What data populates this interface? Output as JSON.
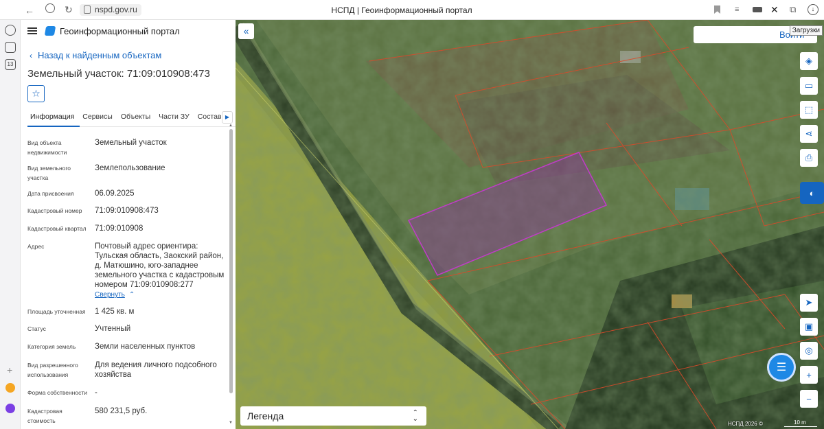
{
  "browser": {
    "url": "nspd.gov.ru",
    "tab_title": "НСПД | Геоинформационный портал",
    "tooltip": "Загрузки",
    "sidebar_counter": "13"
  },
  "header": {
    "portal_title": "Геоинформационный портал",
    "back_link": "Назад к найденным объектам",
    "object_title": "Земельный участок: 71:09:010908:473"
  },
  "tabs": [
    {
      "label": "Информация"
    },
    {
      "label": "Сервисы"
    },
    {
      "label": "Объекты"
    },
    {
      "label": "Части ЗУ"
    },
    {
      "label": "Состав"
    }
  ],
  "fields": [
    {
      "label": "Вид объекта недвижимости",
      "value": "Земельный участок"
    },
    {
      "label": "Вид земельного участка",
      "value": "Землепользование"
    },
    {
      "label": "Дата присвоения",
      "value": "06.09.2025"
    },
    {
      "label": "Кадастровый номер",
      "value": "71:09:010908:473"
    },
    {
      "label": "Кадастровый квартал",
      "value": "71:09:010908"
    },
    {
      "label": "Адрес",
      "value": "Почтовый адрес ориентира: Тульская область, Заокский район, д. Матюшино, юго-западнее земельного участка с кадастровым номером 71:09:010908:277"
    },
    {
      "label": "Площадь уточненная",
      "value": "1 425 кв. м"
    },
    {
      "label": "Статус",
      "value": "Учтенный"
    },
    {
      "label": "Категория земель",
      "value": "Земли населенных пунктов"
    },
    {
      "label": "Вид разрешенного использования",
      "value": "Для ведения личного подсобного хозяйства"
    },
    {
      "label": "Форма собственности",
      "value": "-"
    },
    {
      "label": "Кадастровая стоимость",
      "value": "580 231,5 руб."
    }
  ],
  "collapse_link": "Свернуть",
  "map": {
    "login_label": "Войти",
    "legend_label": "Легенда",
    "copyright": "НСПД 2026 ©",
    "scale_label": "10 m",
    "accent_color": "#1565c0",
    "parcel_highlight_color": "#c03cc8",
    "boundary_color": "#d94a2a"
  }
}
